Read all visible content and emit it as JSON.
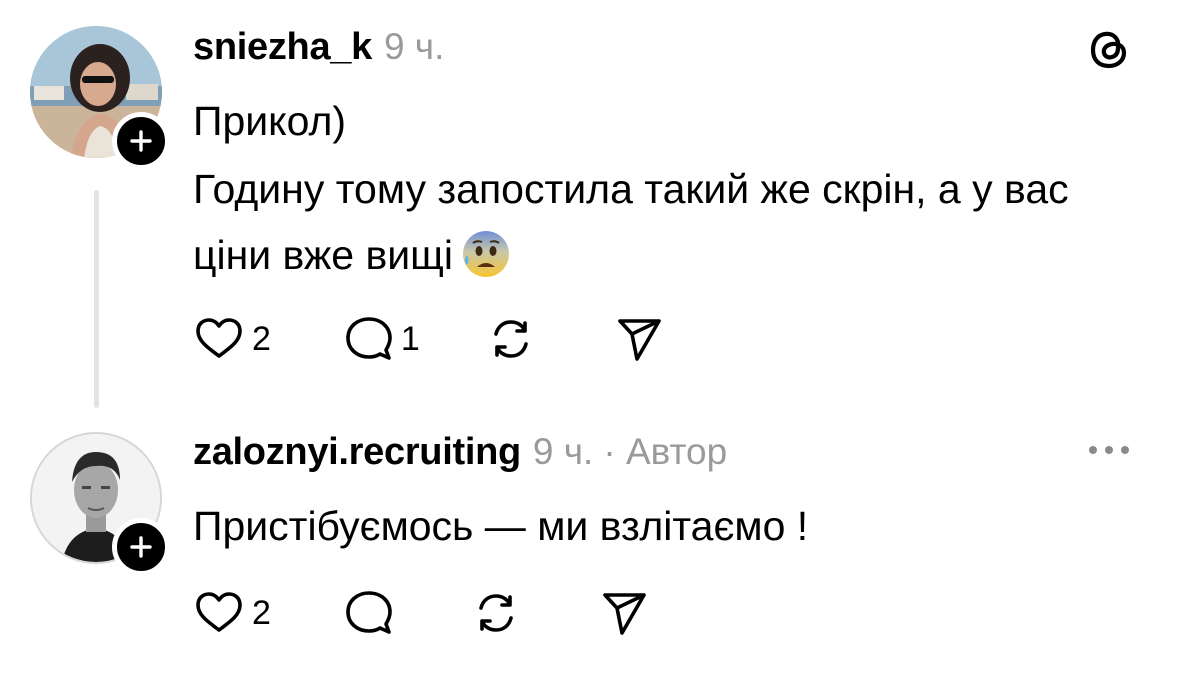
{
  "comments": [
    {
      "username": "sniezha_k",
      "time": "9 ч.",
      "paragraphs": [
        "Прикол)",
        "Годину тому запостила такий же скрін, а у вас ціни вже вищі"
      ],
      "emoji": "anxious-face-with-sweat",
      "likes": "2",
      "replies": "1",
      "avatar": "profile-photo-woman",
      "header_icon": "threads-logo-icon"
    },
    {
      "username": "zaloznyi.recruiting",
      "time": "9 ч.",
      "author_badge": "· Автор",
      "paragraphs": [
        "Пристібуємось — ми взлітаємо !"
      ],
      "likes": "2",
      "avatar": "profile-photo-man",
      "header_icon": "more-options-icon"
    }
  ],
  "colors": {
    "text": "#000000",
    "secondary": "#9a9a9a",
    "thread_line": "#e3e3e3"
  }
}
